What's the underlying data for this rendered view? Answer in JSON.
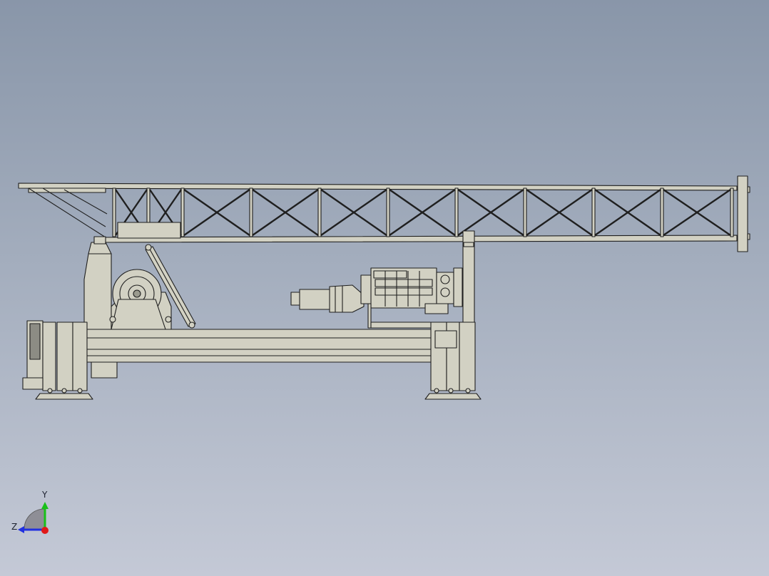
{
  "view": {
    "background_top": "#8996a9",
    "background_bottom": "#c4c9d6",
    "part_fill": "#d2d1c3",
    "edge_color": "#1f1f1f"
  },
  "triad": {
    "y_label": "Y",
    "z_label": "Z",
    "x_color": "#e01818",
    "y_color": "#18c018",
    "z_color": "#2030e0"
  }
}
